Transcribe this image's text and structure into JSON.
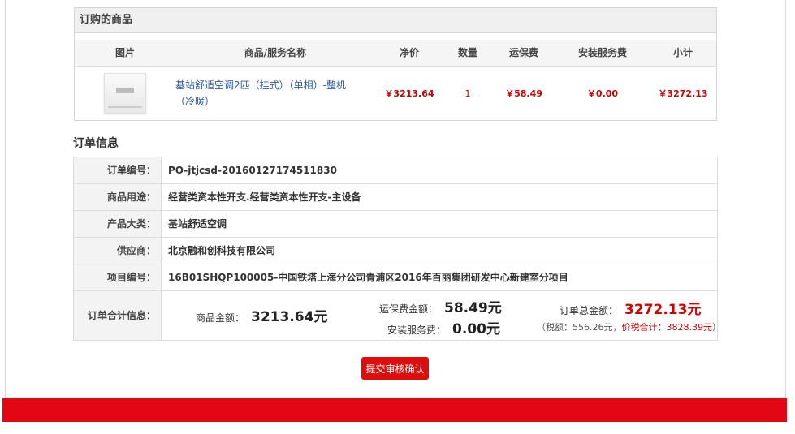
{
  "products": {
    "title": "订购的商品",
    "headers": [
      "图片",
      "商品/服务名称",
      "净价",
      "数量",
      "运保费",
      "安装服务费",
      "小计"
    ],
    "row": {
      "name_line1": "基站舒适空调2匹（挂式）（单相）-整机",
      "name_line2": "（冷暖）",
      "price": "￥3213.64",
      "qty": "1",
      "shipping": "￥58.49",
      "service": "￥0.00",
      "subtotal": "￥3272.13"
    }
  },
  "order": {
    "title": "订单信息",
    "rows": [
      {
        "label": "订单编号：",
        "value": "PO-jtjcsd-20160127174511830"
      },
      {
        "label": "商品用途：",
        "value": "经营类资本性开支.经营类资本性开支-主设备"
      },
      {
        "label": "产品大类：",
        "value": "基站舒适空调"
      },
      {
        "label": "供应商：",
        "value": "北京融和创科技有限公司"
      },
      {
        "label": "项目编号：",
        "value": "16B01SHQP100005-中国铁塔上海分公司青浦区2016年百丽集团研发中心新建室分项目"
      }
    ],
    "total_label": "订单合计信息：",
    "goods_label": "商品金额：",
    "goods_value": "3213.64元",
    "shipping_label": "运保费金额：",
    "shipping_value": "58.49元",
    "service_label": "安装服务费：",
    "service_value": "0.00元",
    "grand_label": "订单总金额：",
    "grand_value": "3272.13元",
    "tax_prefix": "（税额：556.26元，",
    "tax_total": "价税合计：3828.39元",
    "tax_suffix": "）"
  },
  "submit_label": "提交审核确认",
  "colors": {
    "accent": "#e30613",
    "price": "#cc0000",
    "link": "#2a5a9a"
  }
}
